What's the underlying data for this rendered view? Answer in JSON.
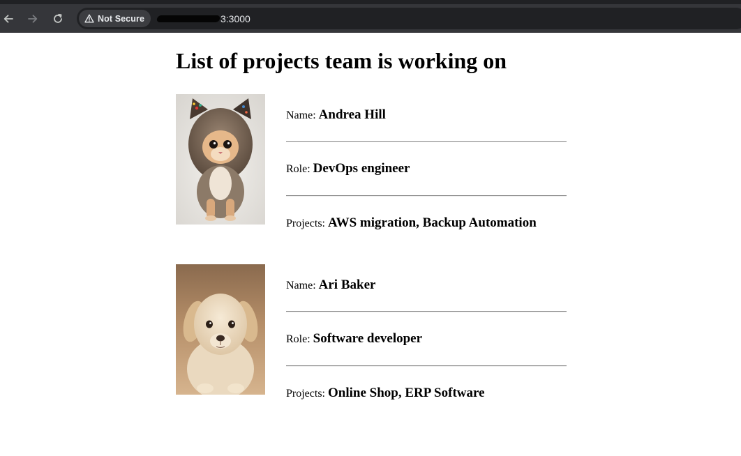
{
  "browser": {
    "security_label": "Not Secure",
    "url_visible": "3:3000",
    "icons": {
      "back": "arrow-left-icon",
      "forward": "arrow-right-icon",
      "reload": "reload-icon",
      "security": "warning-triangle-icon"
    }
  },
  "page": {
    "title": "List of projects team is working on",
    "members": [
      {
        "photo": "kitten-in-hat-photo",
        "name_label": "Name:",
        "name": "Andrea Hill",
        "role_label": "Role:",
        "role": "DevOps engineer",
        "projects_label": "Projects:",
        "projects": "AWS migration, Backup Automation"
      },
      {
        "photo": "puppy-photo",
        "name_label": "Name:",
        "name": "Ari Baker",
        "role_label": "Role:",
        "role": "Software developer",
        "projects_label": "Projects:",
        "projects": "Online Shop, ERP Software"
      }
    ]
  },
  "colors": {
    "chrome_bg": "#35363a",
    "omnibox_bg": "#202124",
    "page_bg": "#ffffff",
    "divider": "#8a8a8a"
  }
}
